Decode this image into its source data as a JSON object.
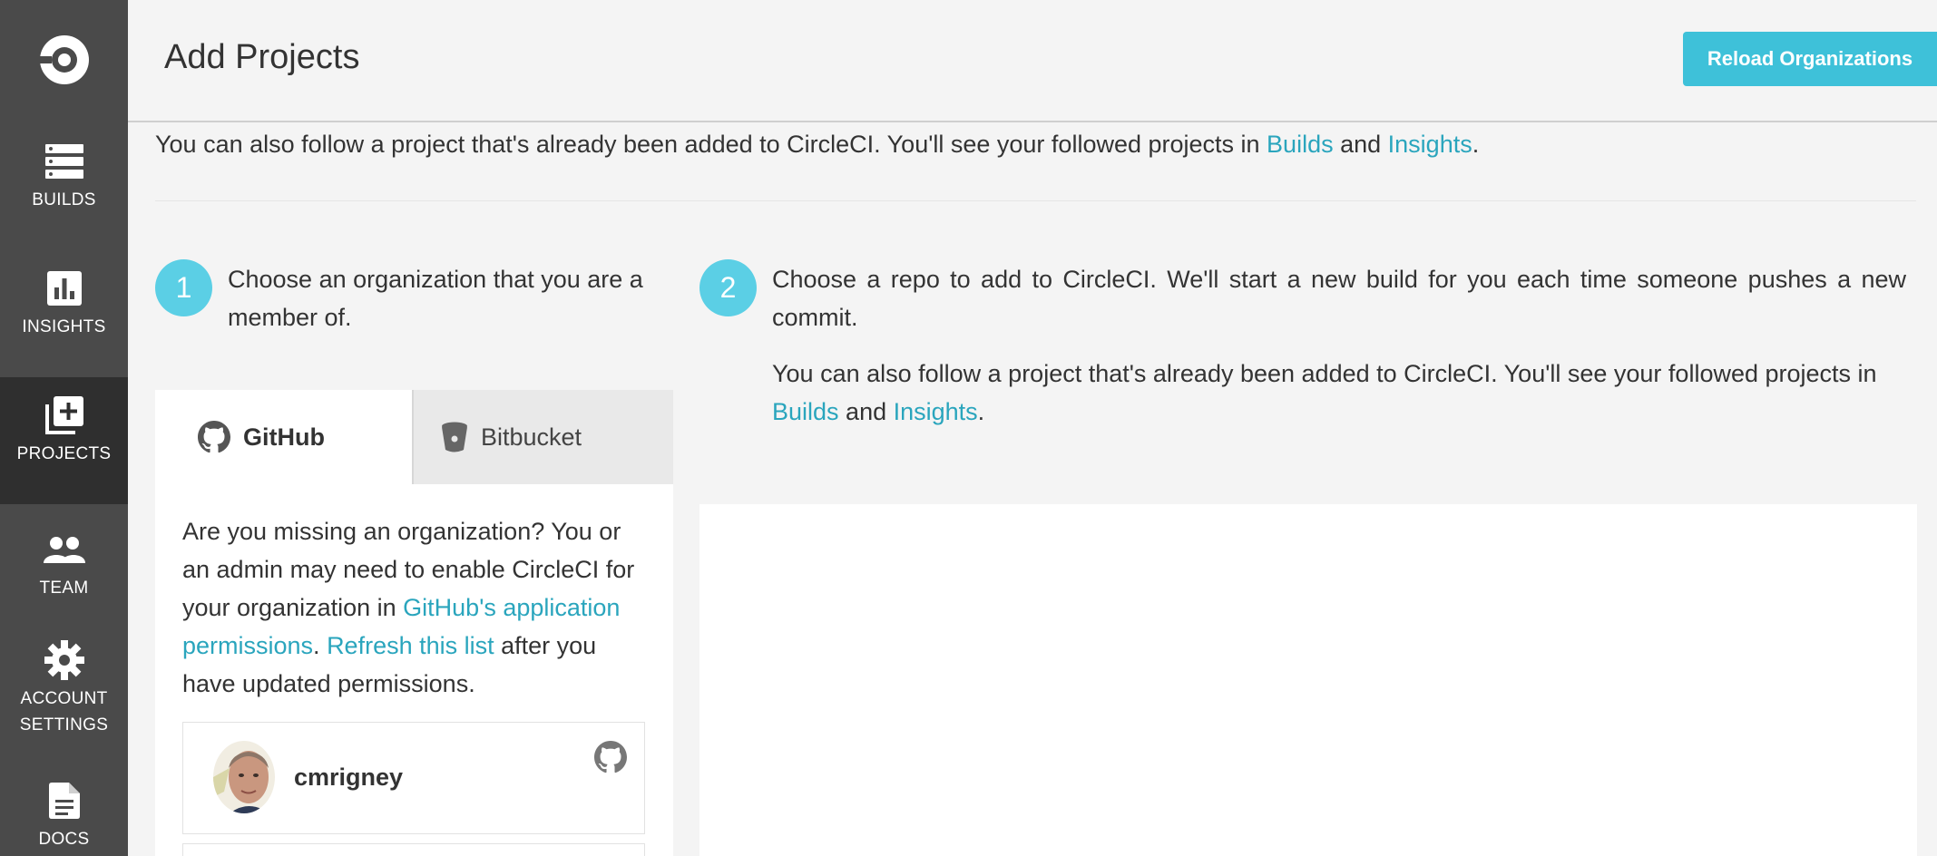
{
  "sidebar": {
    "logo": "circleci-logo",
    "items": [
      {
        "label": "BUILDS",
        "icon": "builds-icon"
      },
      {
        "label": "INSIGHTS",
        "icon": "insights-icon"
      },
      {
        "label": "PROJECTS",
        "icon": "projects-add-icon",
        "active": true
      },
      {
        "label": "TEAM",
        "icon": "team-icon"
      },
      {
        "label": "ACCOUNT",
        "label2": "SETTINGS",
        "icon": "gear-icon"
      },
      {
        "label": "DOCS",
        "icon": "docs-icon"
      }
    ]
  },
  "header": {
    "title": "Add Projects",
    "reload_button": "Reload Organizations"
  },
  "intro": {
    "text_before": "You can also follow a project that's already been added to CircleCI. You'll see your followed projects in ",
    "builds_link": "Builds",
    "and": " and ",
    "insights_link": "Insights",
    "period": "."
  },
  "step1": {
    "number": "1",
    "text": "Choose an organization that you are a member of."
  },
  "step2": {
    "number": "2",
    "text": "Choose a repo to add to CircleCI. We'll start a new build for you each time someone pushes a new commit.",
    "follow_before": "You can also follow a project that's already been added to CircleCI. You'll see your followed projects in ",
    "builds_link": "Builds",
    "and": " and ",
    "insights_link": "Insights",
    "period": "."
  },
  "vcs_tabs": {
    "github": "GitHub",
    "bitbucket": "Bitbucket"
  },
  "missing_org": {
    "text1": "Are you missing an organization? You or an admin may need to enable CircleCI for your organization in ",
    "permissions_link": "GitHub's application permissions",
    "text2": ". ",
    "refresh_link": "Refresh this list",
    "text3": " after you have updated permissions."
  },
  "organizations": [
    {
      "name": "cmrigney",
      "vcs_icon": "github-icon"
    }
  ],
  "colors": {
    "sidebar": "#4a4a4a",
    "sidebar_active": "#2f2f2f",
    "accent": "#3ec1d9",
    "link": "#2aa5bd",
    "step_circle": "#5bcfe5"
  }
}
